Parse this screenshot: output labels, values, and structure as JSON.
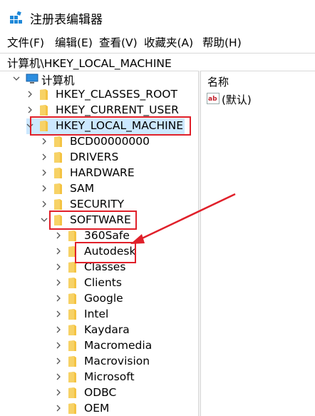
{
  "window": {
    "title": "注册表编辑器"
  },
  "menu": [
    {
      "label": "文件(F)"
    },
    {
      "label": "编辑(E)"
    },
    {
      "label": "查看(V)"
    },
    {
      "label": "收藏夹(A)"
    },
    {
      "label": "帮助(H)"
    }
  ],
  "address": {
    "path": "计算机\\HKEY_LOCAL_MACHINE"
  },
  "tree": {
    "root": "计算机",
    "hives": [
      "HKEY_CLASSES_ROOT",
      "HKEY_CURRENT_USER",
      "HKEY_LOCAL_MACHINE"
    ],
    "hklm_children": [
      "BCD00000000",
      "DRIVERS",
      "HARDWARE",
      "SAM",
      "SECURITY",
      "SOFTWARE"
    ],
    "software_children": [
      "360Safe",
      "Autodesk",
      "Classes",
      "Clients",
      "Google",
      "Intel",
      "Kaydara",
      "Macromedia",
      "Macrovision",
      "Microsoft",
      "ODBC",
      "OEM"
    ]
  },
  "values_pane": {
    "column_name": "名称",
    "rows": [
      {
        "name": "(默认)",
        "icon": "ab-string-icon"
      }
    ]
  },
  "colors": {
    "folder": "#f4c343",
    "highlight": "#e0202a",
    "selection": "#cce8ff"
  }
}
